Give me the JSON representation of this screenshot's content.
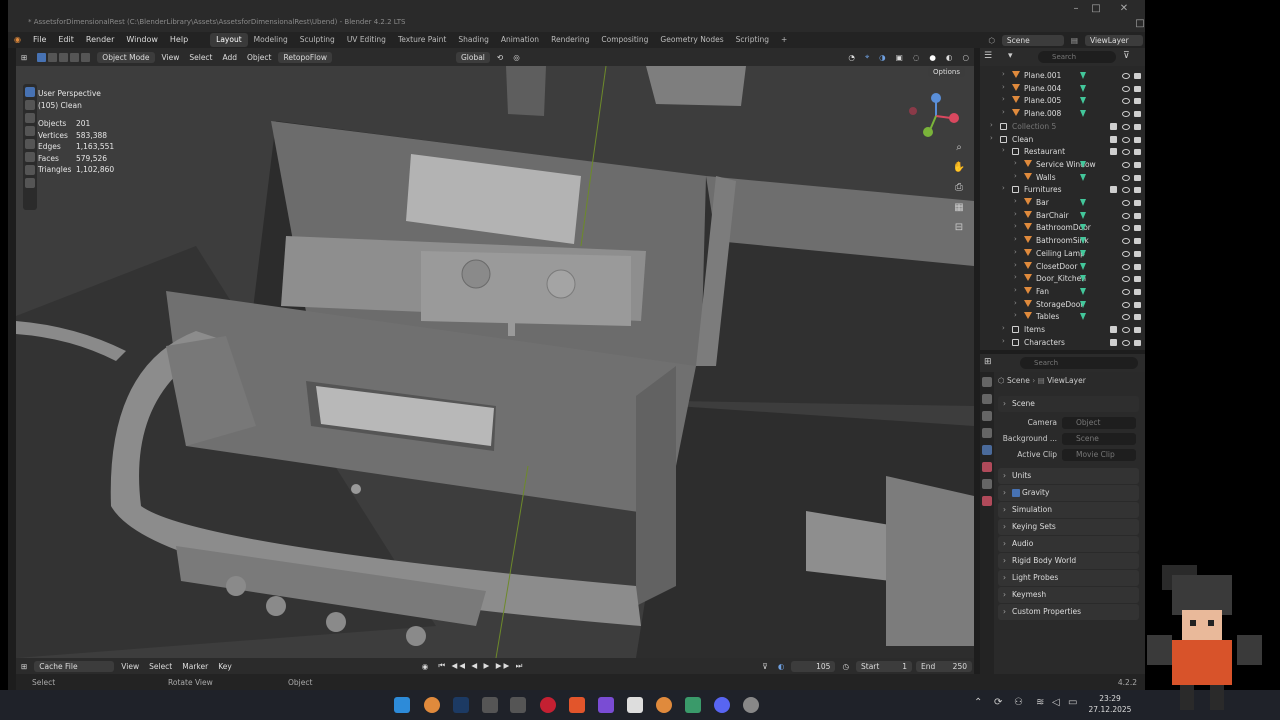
{
  "window": {
    "title": "* AssetsforDimensionalRest (C:\\BlenderLibrary\\Assets\\AssetsforDimensionalRest\\Ubend) - Blender 4.2.2 LTS",
    "scene_label": "Scene",
    "viewlayer_label": "ViewLayer"
  },
  "menu": [
    "File",
    "Edit",
    "Render",
    "Window",
    "Help"
  ],
  "workspaces": [
    "Layout",
    "Modeling",
    "Sculpting",
    "UV Editing",
    "Texture Paint",
    "Shading",
    "Animation",
    "Rendering",
    "Compositing",
    "Geometry Nodes",
    "Scripting",
    "+"
  ],
  "active_workspace": "Layout",
  "viewport_header": {
    "mode": "Object Mode",
    "items": [
      "View",
      "Select",
      "Add",
      "Object",
      "RetopoFlow"
    ],
    "transform": "Global",
    "options": "Options"
  },
  "overlay": {
    "view_name": "User Perspective",
    "collection": "(105) Clean",
    "stats": [
      {
        "label": "Objects",
        "value": "201"
      },
      {
        "label": "Vertices",
        "value": "583,388"
      },
      {
        "label": "Edges",
        "value": "1,163,551"
      },
      {
        "label": "Faces",
        "value": "579,526"
      },
      {
        "label": "Triangles",
        "value": "1,102,860"
      }
    ]
  },
  "outliner": {
    "search_placeholder": "Search",
    "rows": [
      {
        "name": "Plane.001",
        "depth": 1,
        "kind": "object"
      },
      {
        "name": "Plane.004",
        "depth": 1,
        "kind": "object"
      },
      {
        "name": "Plane.005",
        "depth": 1,
        "kind": "object"
      },
      {
        "name": "Plane.008",
        "depth": 1,
        "kind": "object"
      },
      {
        "name": "Collection 5",
        "depth": 0,
        "kind": "collection",
        "dim": true
      },
      {
        "name": "Clean",
        "depth": 0,
        "kind": "collection"
      },
      {
        "name": "Restaurant",
        "depth": 1,
        "kind": "collection"
      },
      {
        "name": "Service Window",
        "depth": 2,
        "kind": "object"
      },
      {
        "name": "Walls",
        "depth": 2,
        "kind": "object"
      },
      {
        "name": "Furnitures",
        "depth": 1,
        "kind": "collection"
      },
      {
        "name": "Bar",
        "depth": 2,
        "kind": "object"
      },
      {
        "name": "BarChair",
        "depth": 2,
        "kind": "object"
      },
      {
        "name": "BathroomDoor",
        "depth": 2,
        "kind": "object"
      },
      {
        "name": "BathroomSink",
        "depth": 2,
        "kind": "object"
      },
      {
        "name": "Ceiling Lamp",
        "depth": 2,
        "kind": "object"
      },
      {
        "name": "ClosetDoor",
        "depth": 2,
        "kind": "object"
      },
      {
        "name": "Door_Kitchen",
        "depth": 2,
        "kind": "object"
      },
      {
        "name": "Fan",
        "depth": 2,
        "kind": "object"
      },
      {
        "name": "StorageDoor",
        "depth": 2,
        "kind": "object"
      },
      {
        "name": "Tables",
        "depth": 2,
        "kind": "object"
      },
      {
        "name": "Items",
        "depth": 1,
        "kind": "collection"
      },
      {
        "name": "Characters",
        "depth": 1,
        "kind": "collection"
      }
    ]
  },
  "properties": {
    "search_placeholder": "Search",
    "breadcrumb": [
      "Scene",
      "ViewLayer"
    ],
    "scene_panel": "Scene",
    "fields": [
      {
        "label": "Camera",
        "placeholder": "Object"
      },
      {
        "label": "Background ...",
        "placeholder": "Scene"
      },
      {
        "label": "Active Clip",
        "placeholder": "Movie Clip"
      }
    ],
    "panels": [
      "Units",
      "Gravity",
      "Simulation",
      "Keying Sets",
      "Audio",
      "Rigid Body World",
      "Light Probes",
      "Keymesh",
      "Custom Properties"
    ]
  },
  "timeline": {
    "cache": "Cache File",
    "items": [
      "View",
      "Select",
      "Marker",
      "Key"
    ],
    "current_frame": "105",
    "start_label": "Start",
    "start": "1",
    "end_label": "End",
    "end": "250"
  },
  "statusbar": {
    "select": "Select",
    "rotate": "Rotate View",
    "object": "Object",
    "version": "4.2.2"
  },
  "taskbar": {
    "time": "23:29",
    "date": "27.12.2025"
  },
  "colors": {
    "accent": "#4772b3",
    "object_icon": "#e08a3c",
    "mesh_data": "#43c79b"
  }
}
